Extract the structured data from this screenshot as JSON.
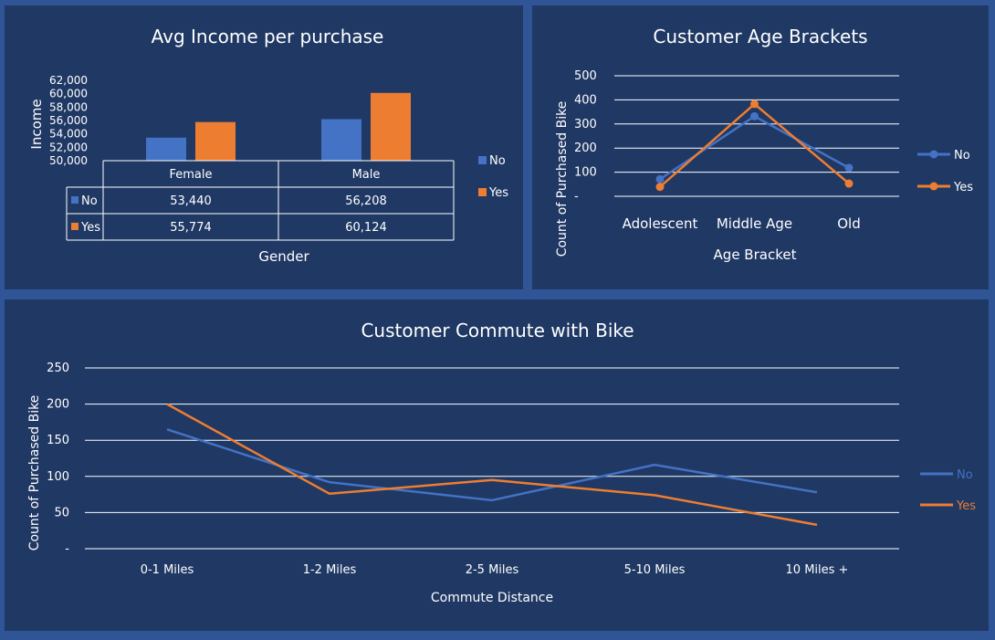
{
  "colors": {
    "no": "#4472c4",
    "yes": "#ed7d31",
    "grid": "#ffffff",
    "panel": "#1f3864",
    "background": "#2f5597"
  },
  "chart_data": [
    {
      "type": "bar",
      "title": "Avg Income per purchase",
      "xlabel": "Gender",
      "ylabel": "Income",
      "categories": [
        "Female",
        "Male"
      ],
      "ylim": [
        50000,
        62000
      ],
      "yticks": [
        "50,000",
        "52,000",
        "54,000",
        "56,000",
        "58,000",
        "60,000",
        "62,000"
      ],
      "legend_placement": "right",
      "data_table": true,
      "series": [
        {
          "name": "No",
          "values": [
            53440,
            56208
          ],
          "labels": [
            "53,440",
            "56,208"
          ]
        },
        {
          "name": "Yes",
          "values": [
            55774,
            60124
          ],
          "labels": [
            "55,774",
            "60,124"
          ]
        }
      ]
    },
    {
      "type": "line",
      "title": "Customer Age Brackets",
      "xlabel": "Age Bracket",
      "ylabel": "Count of Purchased Bike",
      "categories": [
        "Adolescent",
        "Middle Age",
        "Old"
      ],
      "ylim": [
        0,
        500
      ],
      "yticks": [
        "-",
        "100",
        "200",
        "300",
        "400",
        "500"
      ],
      "grid": true,
      "markers": true,
      "legend_placement": "right",
      "series": [
        {
          "name": "No",
          "values": [
            71,
            332,
            118
          ]
        },
        {
          "name": "Yes",
          "values": [
            39,
            383,
            53
          ]
        }
      ]
    },
    {
      "type": "line",
      "title": "Customer Commute with Bike",
      "xlabel": "Commute Distance",
      "ylabel": "Count of Purchased Bike",
      "categories": [
        "0-1 Miles",
        "1-2 Miles",
        "2-5 Miles",
        "5-10 Miles",
        "10 Miles +"
      ],
      "ylim": [
        0,
        250
      ],
      "yticks": [
        "-",
        "50",
        "100",
        "150",
        "200",
        "250"
      ],
      "grid": true,
      "markers": false,
      "legend_placement": "right",
      "series": [
        {
          "name": "No",
          "values": [
            165,
            92,
            67,
            116,
            78
          ]
        },
        {
          "name": "Yes",
          "values": [
            200,
            76,
            95,
            74,
            33
          ]
        }
      ]
    }
  ]
}
